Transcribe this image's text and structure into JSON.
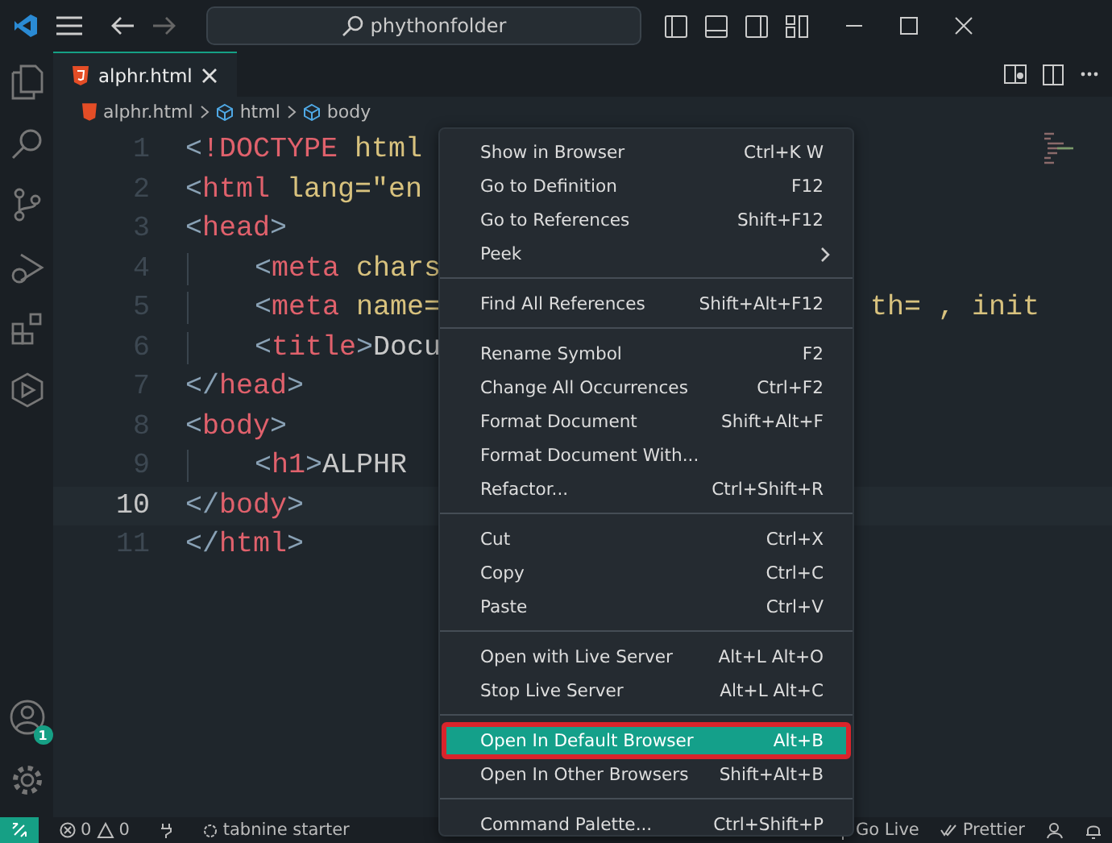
{
  "title_bar": {
    "search": "phythonfolder"
  },
  "tab": {
    "label": "alphr.html",
    "selected": true
  },
  "breadcrumb": [
    "alphr.html",
    "html",
    "body"
  ],
  "editor": {
    "lines": [
      {
        "number": "1",
        "current": false,
        "tokens": [
          {
            "t": "<",
            "kind": "punct"
          },
          {
            "t": "!DOCTYPE",
            "kind": "tag"
          },
          {
            "t": " html",
            "kind": "attr"
          }
        ]
      },
      {
        "number": "2",
        "current": false,
        "tokens": [
          {
            "t": "<",
            "kind": "punct"
          },
          {
            "t": "html",
            "kind": "tag"
          },
          {
            "t": " lang=\"en",
            "kind": "attr"
          }
        ]
      },
      {
        "number": "3",
        "current": false,
        "tokens": [
          {
            "t": "<",
            "kind": "punct"
          },
          {
            "t": "head",
            "kind": "tag"
          },
          {
            "t": ">",
            "kind": "punct"
          }
        ]
      },
      {
        "number": "4",
        "current": false,
        "indent": true,
        "tokens": [
          {
            "t": "<",
            "kind": "punct"
          },
          {
            "t": "meta",
            "kind": "tag"
          },
          {
            "t": " chars",
            "kind": "attr"
          }
        ]
      },
      {
        "number": "5",
        "current": false,
        "indent": true,
        "tokens": [
          {
            "t": "<",
            "kind": "punct"
          },
          {
            "t": "meta",
            "kind": "tag"
          },
          {
            "t": " name=",
            "kind": "attr"
          }
        ],
        "tail": [
          {
            "t": "th= , init",
            "kind": "attr"
          }
        ]
      },
      {
        "number": "6",
        "current": false,
        "indent": true,
        "tokens": [
          {
            "t": "<",
            "kind": "punct"
          },
          {
            "t": "title",
            "kind": "tag"
          },
          {
            "t": ">",
            "kind": "punct"
          },
          {
            "t": "Docu",
            "kind": "text"
          }
        ]
      },
      {
        "number": "7",
        "current": false,
        "tokens": [
          {
            "t": "</",
            "kind": "punct"
          },
          {
            "t": "head",
            "kind": "tag"
          },
          {
            "t": ">",
            "kind": "punct"
          }
        ]
      },
      {
        "number": "8",
        "current": false,
        "tokens": [
          {
            "t": "<",
            "kind": "punct"
          },
          {
            "t": "body",
            "kind": "tag"
          },
          {
            "t": ">",
            "kind": "punct"
          }
        ]
      },
      {
        "number": "9",
        "current": false,
        "indent": true,
        "tokens": [
          {
            "t": "<",
            "kind": "punct"
          },
          {
            "t": "h1",
            "kind": "tag"
          },
          {
            "t": ">",
            "kind": "punct"
          },
          {
            "t": "ALPHR",
            "kind": "text"
          }
        ]
      },
      {
        "number": "10",
        "current": true,
        "tokens": [
          {
            "t": "</",
            "kind": "punct"
          },
          {
            "t": "body",
            "kind": "tag"
          },
          {
            "t": ">",
            "kind": "punct"
          }
        ]
      },
      {
        "number": "11",
        "current": false,
        "tokens": [
          {
            "t": "</",
            "kind": "punct"
          },
          {
            "t": "html",
            "kind": "tag"
          },
          {
            "t": ">",
            "kind": "punct"
          }
        ]
      }
    ]
  },
  "context_menu": {
    "groups": [
      [
        {
          "label": "Show in Browser",
          "shortcut": "Ctrl+K W",
          "selected": false
        },
        {
          "label": "Go to Definition",
          "shortcut": "F12",
          "selected": false
        },
        {
          "label": "Go to References",
          "shortcut": "Shift+F12",
          "selected": false
        },
        {
          "label": "Peek",
          "submenu": true,
          "selected": false
        }
      ],
      [
        {
          "label": "Find All References",
          "shortcut": "Shift+Alt+F12",
          "selected": false
        }
      ],
      [
        {
          "label": "Rename Symbol",
          "shortcut": "F2",
          "selected": false
        },
        {
          "label": "Change All Occurrences",
          "shortcut": "Ctrl+F2",
          "selected": false
        },
        {
          "label": "Format Document",
          "shortcut": "Shift+Alt+F",
          "selected": false
        },
        {
          "label": "Format Document With...",
          "selected": false
        },
        {
          "label": "Refactor...",
          "shortcut": "Ctrl+Shift+R",
          "selected": false
        }
      ],
      [
        {
          "label": "Cut",
          "shortcut": "Ctrl+X",
          "selected": false
        },
        {
          "label": "Copy",
          "shortcut": "Ctrl+C",
          "selected": false
        },
        {
          "label": "Paste",
          "shortcut": "Ctrl+V",
          "selected": false
        }
      ],
      [
        {
          "label": "Open with Live Server",
          "shortcut": "Alt+L Alt+O",
          "selected": false
        },
        {
          "label": "Stop Live Server",
          "shortcut": "Alt+L Alt+C",
          "selected": false
        }
      ],
      [
        {
          "label": "Open In Default Browser",
          "shortcut": "Alt+B",
          "selected": true
        },
        {
          "label": "Open In Other Browsers",
          "shortcut": "Shift+Alt+B",
          "selected": false
        }
      ],
      [
        {
          "label": "Command Palette...",
          "shortcut": "Ctrl+Shift+P",
          "selected": false
        }
      ]
    ]
  },
  "accounts_badge": "1",
  "status_bar": {
    "errors": "0",
    "warnings": "0",
    "tabnine": "tabnine starter",
    "go_live": "Go Live",
    "prettier": "Prettier"
  }
}
